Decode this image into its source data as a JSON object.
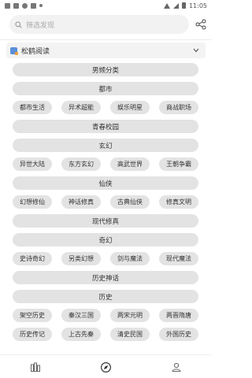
{
  "status_bar": {
    "time": "11:05"
  },
  "search": {
    "placeholder": "筛选发现"
  },
  "source": {
    "name": "松鹤阅读"
  },
  "male_header": "男频分类",
  "groups": [
    {
      "title": "都市",
      "rows": [
        [
          "都市生活",
          "异术超能",
          "娱乐明星",
          "商战职场"
        ]
      ]
    },
    {
      "title": "青春校园",
      "rows": []
    },
    {
      "title": "玄幻",
      "rows": [
        [
          "异世大陆",
          "东方玄幻",
          "高武世界",
          "王朝争霸"
        ]
      ]
    },
    {
      "title": "仙侠",
      "rows": [
        [
          "幻想修仙",
          "神话修真",
          "古典仙侠",
          "修真文明"
        ]
      ]
    },
    {
      "title": "现代修真",
      "rows": []
    },
    {
      "title": "奇幻",
      "rows": [
        [
          "史诗奇幻",
          "另类幻想",
          "剑与魔法",
          "现代魔法"
        ]
      ]
    },
    {
      "title": "历史神话",
      "rows": []
    },
    {
      "title": "历史",
      "rows": [
        [
          "架空历史",
          "秦汉三国",
          "两宋元明",
          "两晋隋唐"
        ],
        [
          "历史传记",
          "上古先秦",
          "清史民国",
          "外国历史"
        ]
      ]
    }
  ],
  "nav": [
    {
      "name": "nav-bookshelf-icon",
      "icon": "bookshelf-icon"
    },
    {
      "name": "nav-explore-icon",
      "icon": "compass-icon",
      "active": true
    },
    {
      "name": "nav-profile-icon",
      "icon": "user-icon"
    }
  ],
  "colors": {
    "chip_bg": "#e3e3e3",
    "search_bg": "#f2f2f2",
    "accent": "#333333"
  }
}
